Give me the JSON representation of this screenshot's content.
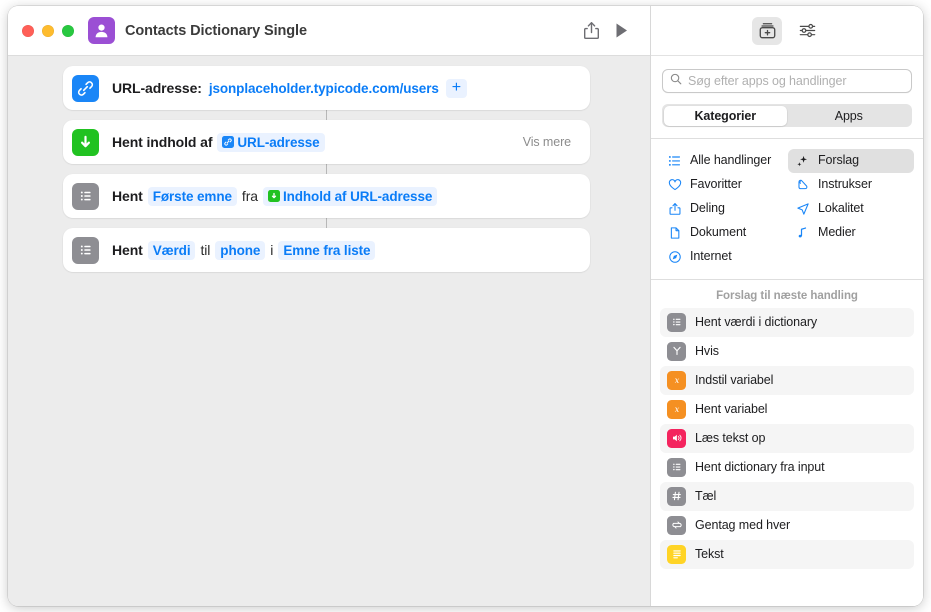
{
  "window": {
    "title": "Contacts Dictionary Single",
    "app_icon": "contacts-person-icon",
    "accent_purple": "#9b4fd4",
    "traffic_lights": [
      "close",
      "minimize",
      "zoom"
    ]
  },
  "toolbar": {
    "share_label": "share-icon",
    "run_label": "play-icon"
  },
  "workflow": {
    "actions": [
      {
        "icon": "link-icon",
        "icon_color": "#1a86f7",
        "label": "URL-adresse:",
        "value_token": "jsonplaceholder.typicode.com/users",
        "add_label": "+"
      },
      {
        "icon": "download-arrow-icon",
        "icon_color": "#21c221",
        "label": "Hent indhold af",
        "variable_token": "URL-adresse",
        "trailing": "Vis mere"
      },
      {
        "icon": "list-icon",
        "icon_color": "#8e8e93",
        "label": "Hent",
        "token1": "Første emne",
        "mid1": "fra",
        "token2": "Indhold af URL-adresse"
      },
      {
        "icon": "list-icon",
        "icon_color": "#8e8e93",
        "label": "Hent",
        "token1": "Værdi",
        "mid1": "til",
        "token2": "phone",
        "mid2": "i",
        "token3": "Emne fra liste"
      }
    ]
  },
  "library": {
    "toolbar": {
      "add_action_icon": "action-library-icon",
      "settings_icon": "sliders-icon"
    },
    "search": {
      "icon": "search-icon",
      "placeholder": "Søg efter apps og handlinger",
      "value": ""
    },
    "segmented": {
      "options": [
        "Kategorier",
        "Apps"
      ],
      "selected": "Kategorier"
    },
    "categories": [
      {
        "label": "Alle handlinger",
        "icon": "list-bullet-icon",
        "selected": false
      },
      {
        "label": "Forslag",
        "icon": "sparkles-icon",
        "selected": true
      },
      {
        "label": "Favoritter",
        "icon": "heart-icon",
        "selected": false
      },
      {
        "label": "Instrukser",
        "icon": "scroll-icon",
        "selected": false
      },
      {
        "label": "Deling",
        "icon": "share-icon",
        "selected": false
      },
      {
        "label": "Lokalitet",
        "icon": "location-arrow-icon",
        "selected": false
      },
      {
        "label": "Dokument",
        "icon": "document-icon",
        "selected": false
      },
      {
        "label": "Medier",
        "icon": "music-note-icon",
        "selected": false
      },
      {
        "label": "Internet",
        "icon": "safari-compass-icon",
        "selected": false
      }
    ],
    "suggestions_header": "Forslag til næste handling",
    "suggestions": [
      {
        "label": "Hent værdi i dictionary",
        "icon": "list-icon",
        "color": "#8e8e93"
      },
      {
        "label": "Hvis",
        "icon": "branch-y-icon",
        "color": "#8e8e93"
      },
      {
        "label": "Indstil variabel",
        "icon": "variable-x-icon",
        "color": "#f59022"
      },
      {
        "label": "Hent variabel",
        "icon": "variable-x-icon",
        "color": "#f59022"
      },
      {
        "label": "Læs tekst op",
        "icon": "speaker-icon",
        "color": "#f4245e"
      },
      {
        "label": "Hent dictionary fra input",
        "icon": "list-icon",
        "color": "#8e8e93"
      },
      {
        "label": "Tæl",
        "icon": "hash-icon",
        "color": "#8e8e93"
      },
      {
        "label": "Gentag med hver",
        "icon": "repeat-icon",
        "color": "#8e8e93"
      },
      {
        "label": "Tekst",
        "icon": "text-lines-icon",
        "color": "#ffd426"
      }
    ]
  }
}
